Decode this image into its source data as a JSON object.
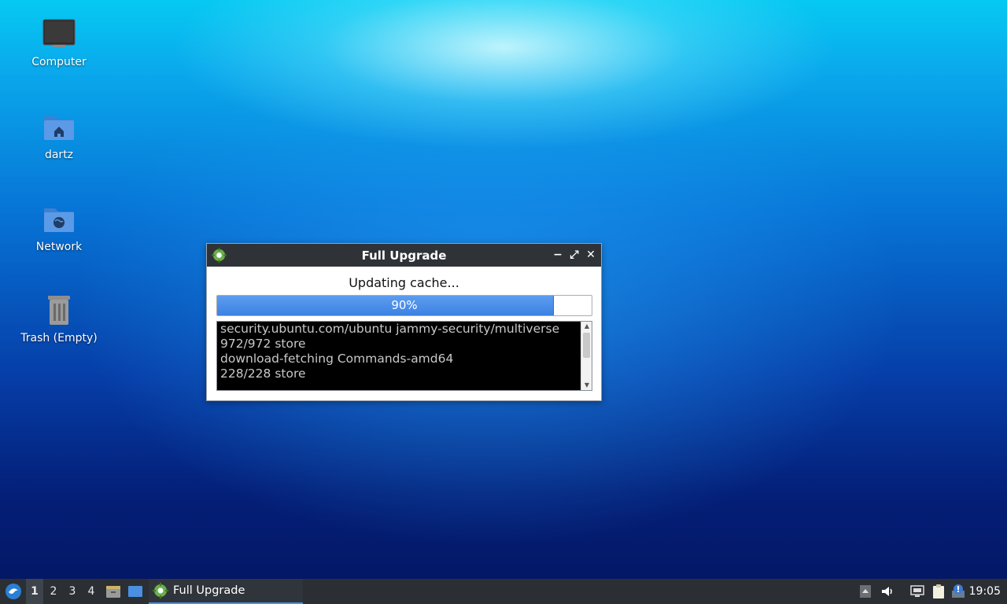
{
  "desktop": {
    "icons": [
      {
        "label": "Computer",
        "icon": "monitor-icon"
      },
      {
        "label": "dartz",
        "icon": "home-folder-icon"
      },
      {
        "label": "Network",
        "icon": "network-folder-icon"
      },
      {
        "label": "Trash (Empty)",
        "icon": "trash-icon"
      }
    ]
  },
  "dialog": {
    "title": "Full Upgrade",
    "app_icon": "gear-icon",
    "controls": {
      "minimize": "−",
      "maximize": "⤢",
      "close": "✕"
    },
    "status": "Updating cache...",
    "progress": {
      "percent": 90,
      "label": "90%"
    },
    "log_lines": [
      "security.ubuntu.com/ubuntu jammy-security/multiverse",
      "972/972 store",
      "download-fetching Commands-amd64",
      "228/228 store"
    ]
  },
  "taskbar": {
    "workspaces": [
      "1",
      "2",
      "3",
      "4"
    ],
    "active_workspace": "1",
    "task_label": "Full Upgrade",
    "clock": "19:05"
  },
  "colors": {
    "accent": "#4a90e2",
    "titlebar": "#2f3338",
    "taskbar": "#2b2f34"
  }
}
